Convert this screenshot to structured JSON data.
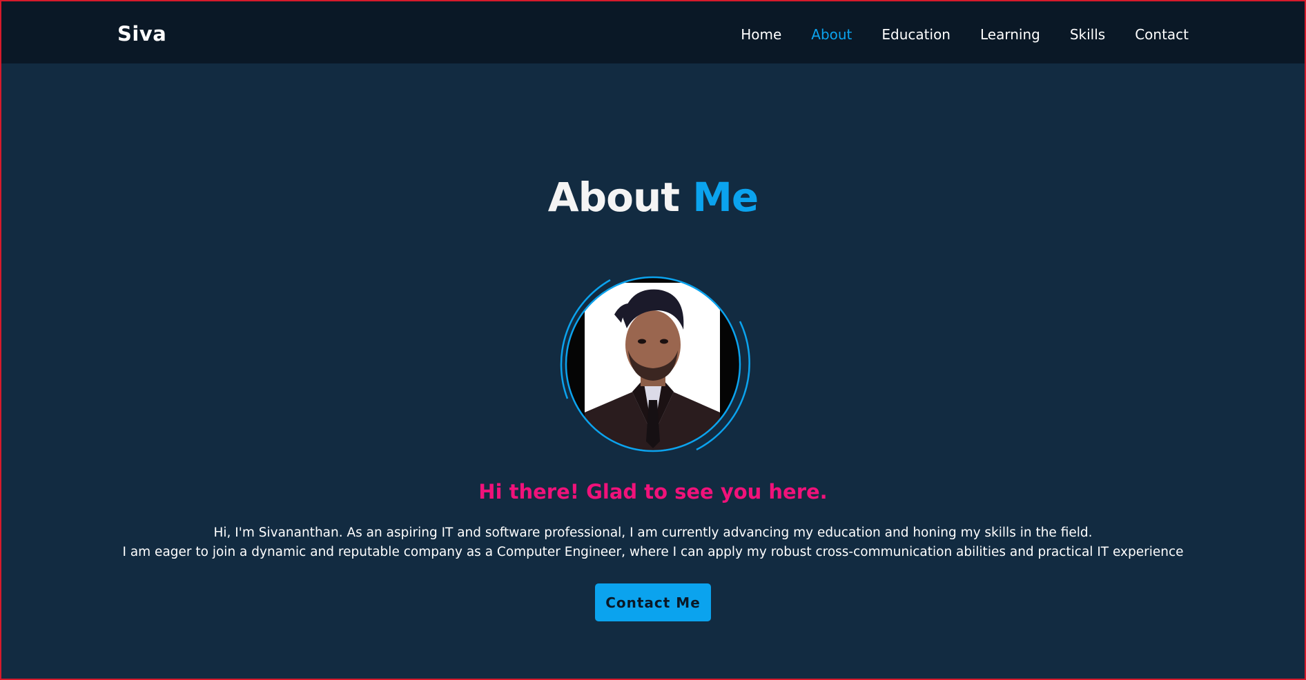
{
  "nav": {
    "brand": "Siva",
    "links": [
      {
        "label": "Home",
        "active": false
      },
      {
        "label": "About",
        "active": true
      },
      {
        "label": "Education",
        "active": false
      },
      {
        "label": "Learning",
        "active": false
      },
      {
        "label": "Skills",
        "active": false
      },
      {
        "label": "Contact",
        "active": false
      }
    ]
  },
  "about": {
    "title_main": "About",
    "title_accent": "Me",
    "avatar_icon": "profile-photo",
    "greeting": "Hi there! Glad to see you here.",
    "bio_line1": "Hi, I'm Sivananthan. As an aspiring IT and software professional, I am currently advancing my education and honing my skills in the field.",
    "bio_line2": "I am eager to join a dynamic and reputable company as a Computer Engineer, where I can apply my robust cross-communication abilities and practical IT experience",
    "cta_label": "Contact Me"
  },
  "colors": {
    "background": "#122b41",
    "navbar": "#0a1826",
    "accent": "#0ba3ee",
    "greeting": "#f0127a",
    "border": "#d61a2b"
  }
}
